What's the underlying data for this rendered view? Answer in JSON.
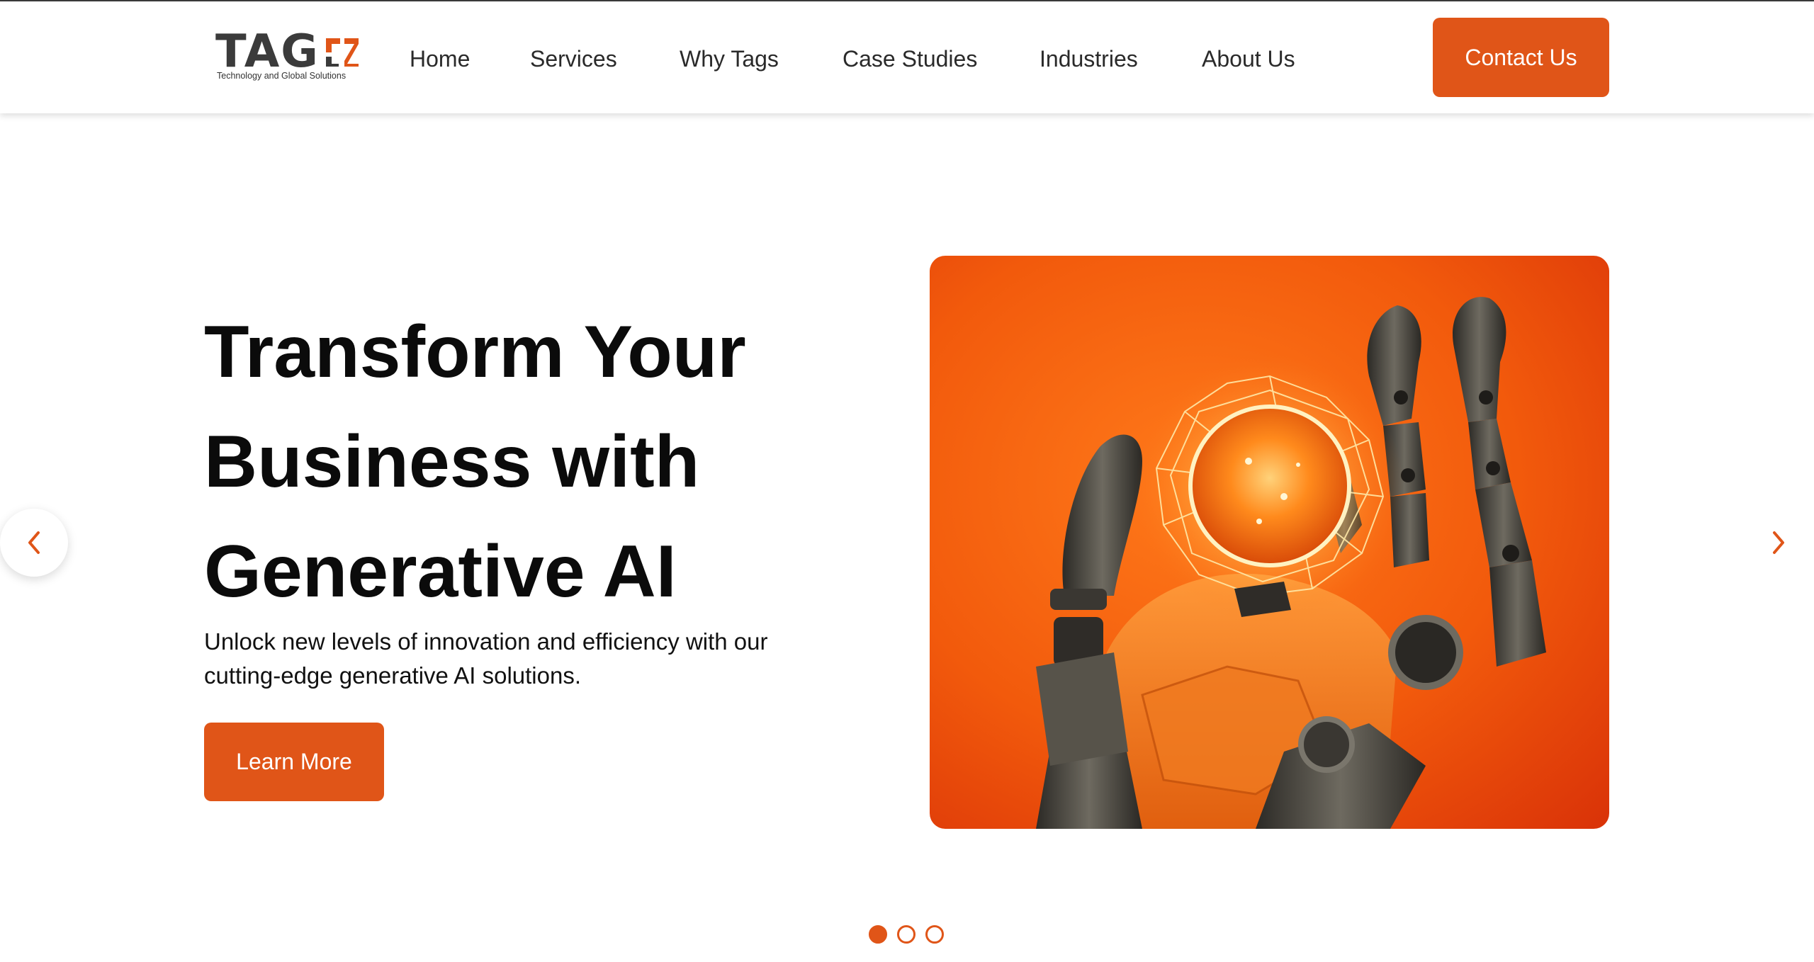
{
  "brand": {
    "name": "TAG",
    "tagline": "Technology and Global Solutions",
    "accent_color": "#e05518"
  },
  "nav": {
    "items": [
      {
        "label": "Home"
      },
      {
        "label": "Services"
      },
      {
        "label": "Why Tags"
      },
      {
        "label": "Case Studies"
      },
      {
        "label": "Industries"
      },
      {
        "label": "About Us"
      }
    ],
    "contact_label": "Contact Us"
  },
  "hero": {
    "title_lines": [
      "Transform Your",
      "Business with",
      "Generative AI"
    ],
    "subtitle": "Unlock new levels of innovation and efficiency with our cutting-edge generative AI solutions.",
    "cta_label": "Learn More",
    "image_icon": "robotic-hand-holding-glowing-orb"
  },
  "carousel": {
    "prev_icon": "chevron-left-icon",
    "next_icon": "chevron-right-icon",
    "slide_count": 3,
    "active_index": 0
  }
}
